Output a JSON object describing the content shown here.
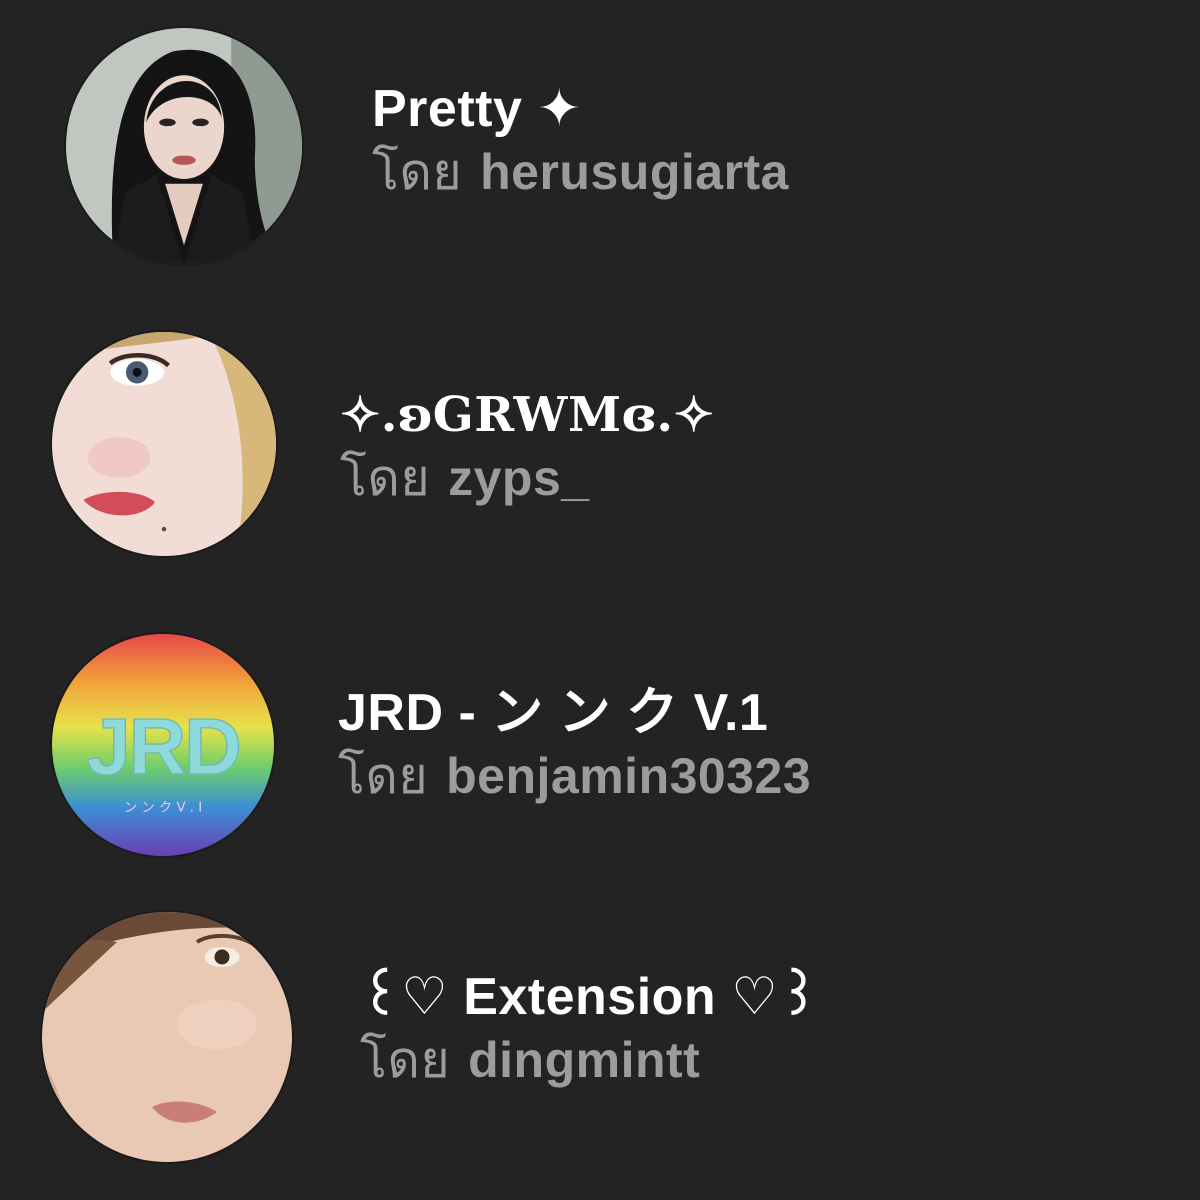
{
  "playlists": [
    {
      "title": "Pretty ✦",
      "by_prefix": "โดย",
      "author": "herusugiarta",
      "avatar_icon": "avatar-photo-woman-dark-hair",
      "accent": "#2e2e2e"
    },
    {
      "title": "✧.ʚGRWMɞ.✧",
      "by_prefix": "โดย",
      "author": "zyps_",
      "avatar_icon": "avatar-photo-face-closeup",
      "accent": "#e8d4c8"
    },
    {
      "title": "JRD - ン ン ク V.1",
      "by_prefix": "โดย",
      "author": "benjamin30323",
      "avatar_icon": "avatar-rainbow-logo",
      "avatar_logo_text": "JRD",
      "avatar_logo_subtext": "ン ン ク V . I",
      "accent": "#8ed9d9"
    },
    {
      "title": "꒰♡ Extension ♡꒱",
      "by_prefix": "โดย",
      "author": "dingmintt",
      "avatar_icon": "avatar-photo-face-smile",
      "accent": "#d9b49a"
    }
  ]
}
